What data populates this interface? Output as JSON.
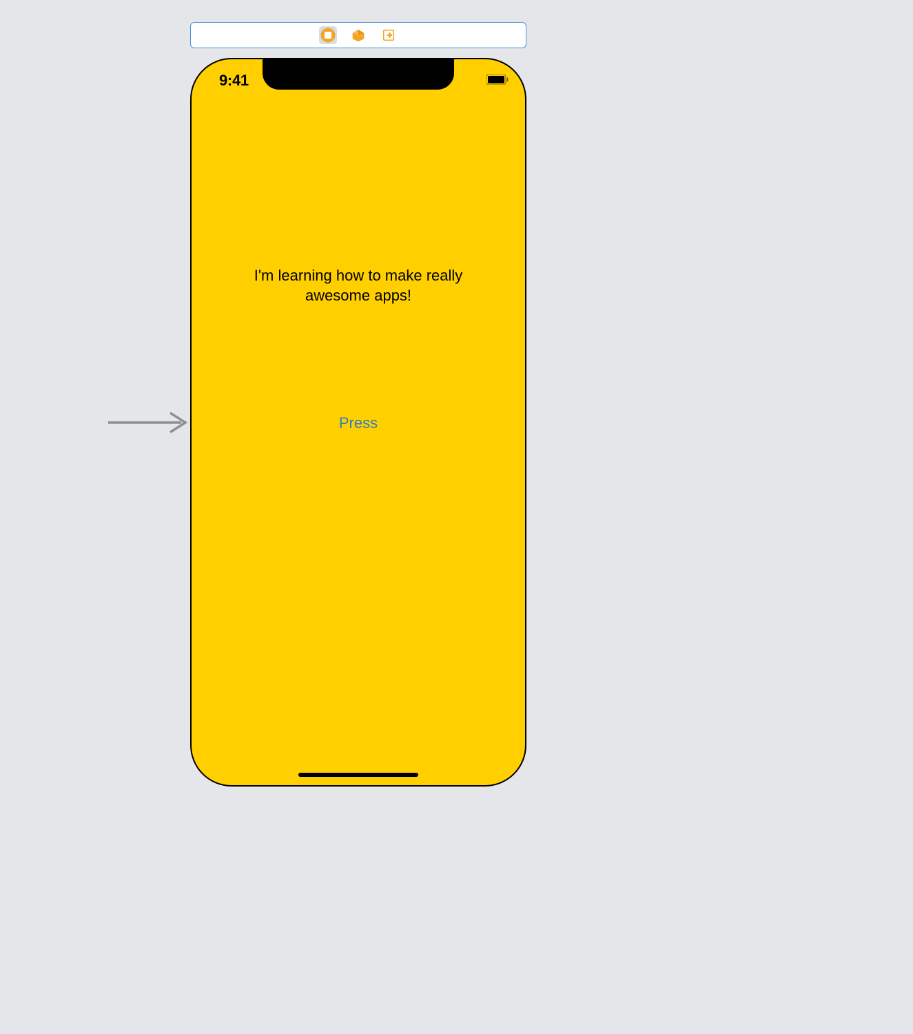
{
  "scene_dock": {
    "view_controller_selected": true
  },
  "status_bar": {
    "time": "9:41"
  },
  "screen": {
    "label_text": "I'm learning how to make really awesome apps!",
    "button_text": "Press"
  },
  "colors": {
    "background": "#ffcf00",
    "button_tint": "#2f7ec2",
    "canvas_bg": "#e5e6e9"
  }
}
